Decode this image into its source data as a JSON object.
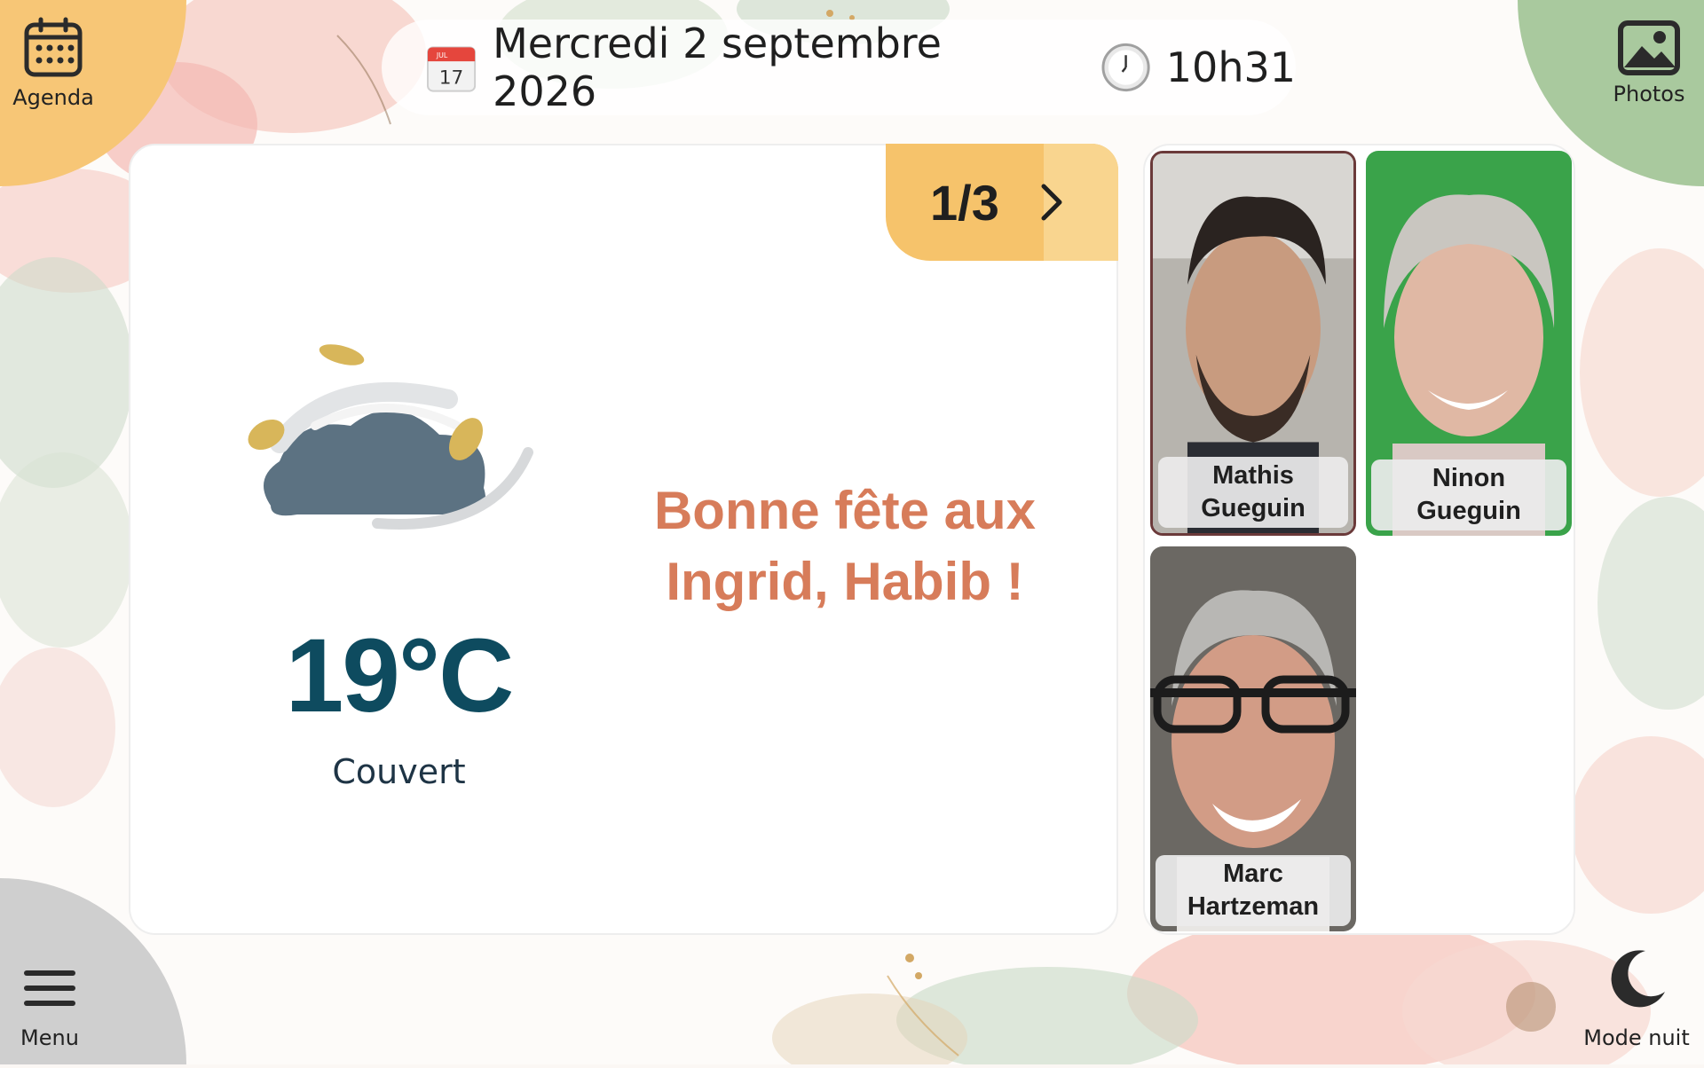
{
  "header": {
    "date": "Mercredi 2 septembre 2026",
    "time": "10h31",
    "calendar_icon_month": "JUL",
    "calendar_icon_day": "17"
  },
  "corners": {
    "agenda": {
      "label": "Agenda",
      "icon": "calendar-icon"
    },
    "photos": {
      "label": "Photos",
      "icon": "image-icon"
    },
    "menu": {
      "label": "Menu",
      "icon": "hamburger-icon"
    },
    "night": {
      "label": "Mode nuit",
      "icon": "moon-icon"
    }
  },
  "weather": {
    "temperature": "19°C",
    "condition": "Couvert",
    "icon": "windy-cloud-icon"
  },
  "pager": {
    "label": "1/3",
    "icon": "chevron-right-icon"
  },
  "message": {
    "line1": "Bonne fête aux",
    "line2": "Ingrid, Habib !"
  },
  "people": [
    {
      "first": "Mathis",
      "last": "Gueguin"
    },
    {
      "first": "Ninon",
      "last": "Gueguin"
    },
    {
      "first": "Marc",
      "last": "Hartzeman"
    }
  ],
  "colors": {
    "agenda": "#f7c676",
    "photos": "#a9c99e",
    "menu": "#cfcfcf",
    "temperature": "#0e4b5f",
    "message": "#d77c5a",
    "pager": "#f6c36b"
  }
}
